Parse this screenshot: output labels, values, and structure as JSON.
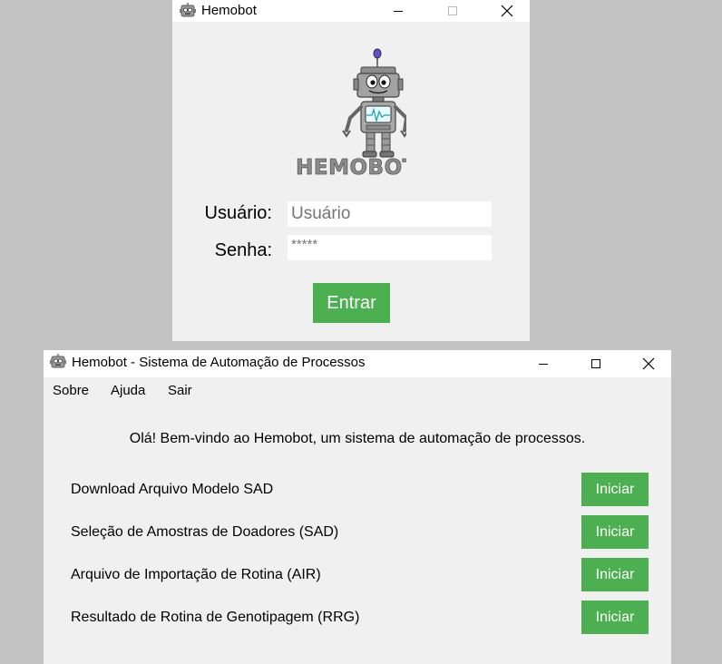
{
  "login_window": {
    "title": "Hemobot",
    "logo_text": "HEMOBOT",
    "user_label": "Usuário:",
    "user_placeholder": "Usuário",
    "password_label": "Senha:",
    "password_value": "*****",
    "submit_label": "Entrar",
    "accent_color": "#4caf50"
  },
  "main_window": {
    "title": "Hemobot - Sistema de Automação de Processos",
    "menu": [
      "Sobre",
      "Ajuda",
      "Sair"
    ],
    "welcome": "Olá! Bem-vindo ao Hemobot, um sistema de automação de processos.",
    "tasks": [
      {
        "label": "Download Arquivo Modelo SAD",
        "button": "Iniciar"
      },
      {
        "label": "Seleção de Amostras de Doadores (SAD)",
        "button": "Iniciar"
      },
      {
        "label": "Arquivo de Importação de Rotina (AIR)",
        "button": "Iniciar"
      },
      {
        "label": "Resultado de Rotina de Genotipagem (RRG)",
        "button": "Iniciar"
      }
    ]
  },
  "icons": [
    "robot-icon",
    "minimize-icon",
    "maximize-icon",
    "close-icon"
  ]
}
